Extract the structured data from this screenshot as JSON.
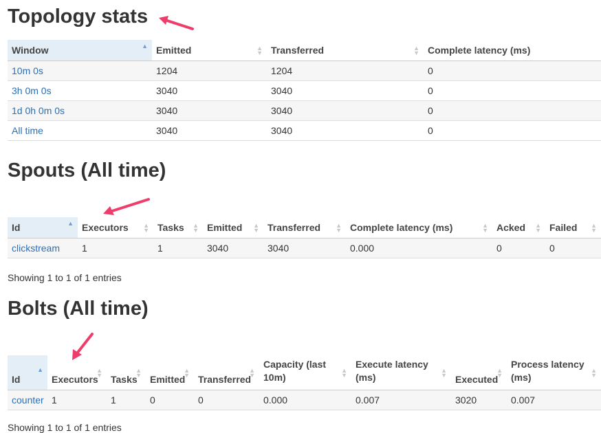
{
  "topology": {
    "title": "Topology stats",
    "headers": [
      "Window",
      "Emitted",
      "Transferred",
      "Complete latency (ms)"
    ],
    "rows": [
      [
        "10m 0s",
        "1204",
        "1204",
        "0"
      ],
      [
        "3h 0m 0s",
        "3040",
        "3040",
        "0"
      ],
      [
        "1d 0h 0m 0s",
        "3040",
        "3040",
        "0"
      ],
      [
        "All time",
        "3040",
        "3040",
        "0"
      ]
    ]
  },
  "spouts": {
    "title": "Spouts (All time)",
    "headers": [
      "Id",
      "Executors",
      "Tasks",
      "Emitted",
      "Transferred",
      "Complete latency (ms)",
      "Acked",
      "Failed"
    ],
    "rows": [
      [
        "clickstream",
        "1",
        "1",
        "3040",
        "3040",
        "0.000",
        "0",
        "0"
      ]
    ],
    "info": "Showing 1 to 1 of 1 entries"
  },
  "bolts": {
    "title": "Bolts (All time)",
    "headers": [
      "Id",
      "Executors",
      "Tasks",
      "Emitted",
      "Transferred",
      "Capacity (last 10m)",
      "Execute latency (ms)",
      "Executed",
      "Process latency (ms)"
    ],
    "rows": [
      [
        "counter",
        "1",
        "1",
        "0",
        "0",
        "0.000",
        "0.007",
        "3020",
        "0.007"
      ]
    ],
    "info": "Showing 1 to 1 of 1 entries"
  },
  "colors": {
    "link": "#2a6fb5",
    "sorted_header_bg": "#e4eef6",
    "annotation_arrow": "#ee3d6b"
  },
  "icons": {
    "sort": "sort-icon",
    "annotation": "arrow-icon"
  }
}
